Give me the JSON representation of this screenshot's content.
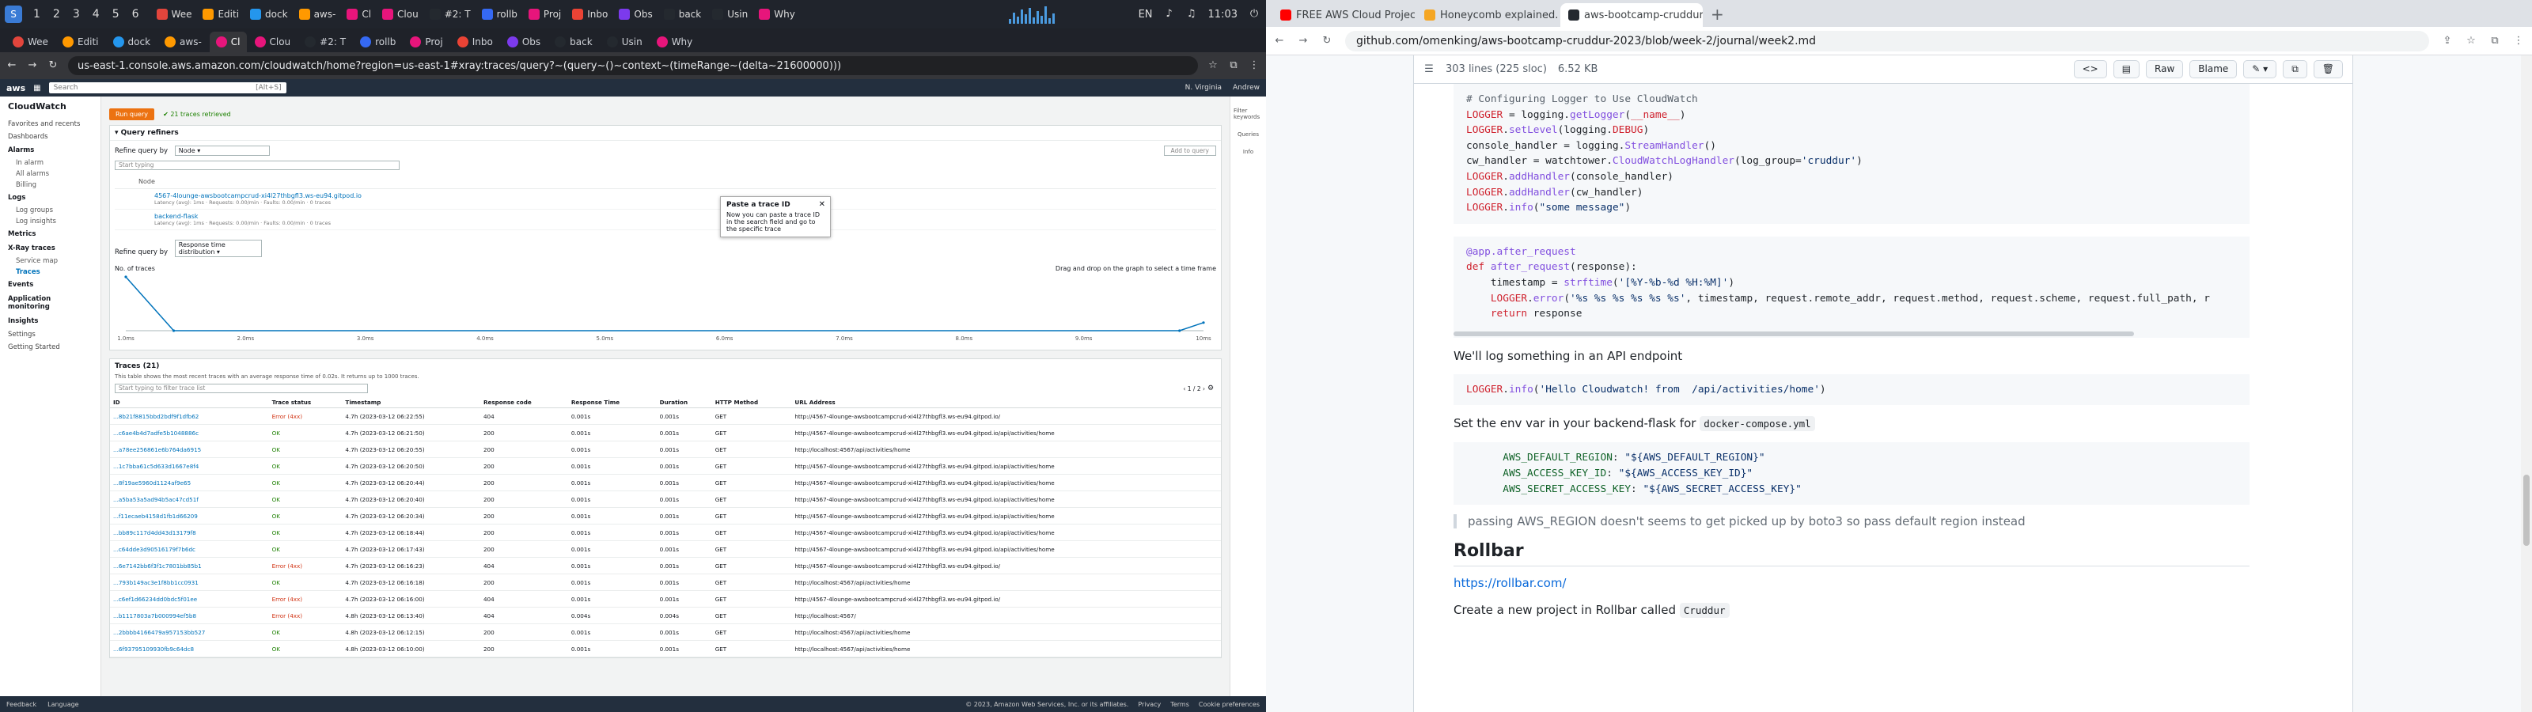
{
  "taskbar": {
    "workspaces": [
      "1",
      "2",
      "3",
      "4",
      "5",
      "6"
    ],
    "windows": [
      {
        "label": "Wee"
      },
      {
        "label": "Editi"
      },
      {
        "label": "dock"
      },
      {
        "label": "aws-"
      },
      {
        "label": "Cl"
      },
      {
        "label": "Clou"
      },
      {
        "label": "#2: T"
      },
      {
        "label": "rollb"
      },
      {
        "label": "Proj"
      },
      {
        "label": "Inbo"
      },
      {
        "label": "Obs"
      },
      {
        "label": "back"
      },
      {
        "label": "Usin"
      },
      {
        "label": "Why"
      }
    ],
    "lang": "EN",
    "time": "11:03"
  },
  "left_browser": {
    "tabs": [
      {
        "label": "Wee"
      },
      {
        "label": "Editi"
      },
      {
        "label": "dock"
      },
      {
        "label": "aws-"
      },
      {
        "label": "Cl"
      },
      {
        "label": "Clou"
      },
      {
        "label": "#2: T"
      },
      {
        "label": "rollb"
      },
      {
        "label": "Proj"
      },
      {
        "label": "Inbo"
      },
      {
        "label": "Obs"
      },
      {
        "label": "back"
      },
      {
        "label": "Usin"
      },
      {
        "label": "Why"
      }
    ],
    "url": "us-east-1.console.aws.amazon.com/cloudwatch/home?region=us-east-1#xray:traces/query?~(query~()~context~(timeRange~(delta~21600000)))"
  },
  "aws": {
    "search_placeholder": "Search",
    "search_hint": "[Alt+S]",
    "top_right": [
      "N. Virginia",
      "Andrew"
    ],
    "sidebar": {
      "title": "CloudWatch",
      "items": [
        {
          "type": "item",
          "label": "Favorites and recents"
        },
        {
          "type": "item",
          "label": "Dashboards"
        },
        {
          "type": "grp",
          "label": "Alarms"
        },
        {
          "type": "sub",
          "label": "In alarm"
        },
        {
          "type": "sub",
          "label": "All alarms"
        },
        {
          "type": "sub",
          "label": "Billing"
        },
        {
          "type": "grp",
          "label": "Logs"
        },
        {
          "type": "sub",
          "label": "Log groups"
        },
        {
          "type": "sub",
          "label": "Log insights"
        },
        {
          "type": "grp",
          "label": "Metrics"
        },
        {
          "type": "grp",
          "label": "X-Ray traces"
        },
        {
          "type": "sub",
          "label": "Service map"
        },
        {
          "type": "sub-active",
          "label": "Traces"
        },
        {
          "type": "grp",
          "label": "Events"
        },
        {
          "type": "grp",
          "label": "Application monitoring"
        },
        {
          "type": "grp",
          "label": "Insights"
        },
        {
          "type": "item",
          "label": "Settings"
        },
        {
          "type": "item",
          "label": "Getting Started"
        }
      ]
    },
    "run_query": "Run query",
    "retrieved": "21 traces retrieved",
    "query_refiners": "Query refiners",
    "refine_label": "Refine query by",
    "refine_value": "Node",
    "filter_placeholder": "Start typing",
    "add_to_query": "Add to query",
    "popup": {
      "title": "Paste a trace ID",
      "body": "Now you can paste a trace ID in the search field and go to the specific trace"
    },
    "nodes_header": "Node",
    "nodes": [
      {
        "name": "4567-4lounge-awsbootcampcrud-xi4l27thbgfl3.ws-eu94.gitpod.io",
        "meta": "Latency (avg): 1ms · Requests: 0.00/min · Faults: 0.00/min · 0 traces"
      },
      {
        "name": "backend-flask",
        "meta": "Latency (avg): 1ms · Requests: 0.00/min · Faults: 0.00/min · 0 traces"
      }
    ],
    "refine2_value": "Response time distribution",
    "chart_hint": "Drag and drop on the graph to select a time frame",
    "traces_title": "Traces (21)",
    "traces_desc": "This table shows the most recent traces with an average response time of 0.02s. It returns up to 1000 traces.",
    "traces_filter": "Start typing to filter trace list",
    "pager": "1 / 2",
    "columns": [
      "ID",
      "Trace status",
      "Timestamp",
      "Response code",
      "Response Time",
      "Duration",
      "HTTP Method",
      "URL Address"
    ],
    "rows": [
      {
        "id": "...8b21f8815bbd2bdf9f1dfb62",
        "status": "Error (4xx)",
        "ts": "4.7h (2023-03-12 06:22:55)",
        "code": "404",
        "rt": "0.001s",
        "dur": "0.001s",
        "m": "GET",
        "url": "http://4567-4lounge-awsbootcampcrud-xi4l27thbgfl3.ws-eu94.gitpod.io/"
      },
      {
        "id": "...c6ae4b4d7adfe5b1048886c",
        "status": "OK",
        "ts": "4.7h (2023-03-12 06:21:50)",
        "code": "200",
        "rt": "0.001s",
        "dur": "0.001s",
        "m": "GET",
        "url": "http://4567-4lounge-awsbootcampcrud-xi4l27thbgfl3.ws-eu94.gitpod.io/api/activities/home"
      },
      {
        "id": "...a78ee256861e6b764da6915",
        "status": "OK",
        "ts": "4.7h (2023-03-12 06:20:55)",
        "code": "200",
        "rt": "0.001s",
        "dur": "0.001s",
        "m": "GET",
        "url": "http://localhost:4567/api/activities/home"
      },
      {
        "id": "...1c7bba61c5d633d1667e8f4",
        "status": "OK",
        "ts": "4.7h (2023-03-12 06:20:50)",
        "code": "200",
        "rt": "0.001s",
        "dur": "0.001s",
        "m": "GET",
        "url": "http://4567-4lounge-awsbootcampcrud-xi4l27thbgfl3.ws-eu94.gitpod.io/api/activities/home"
      },
      {
        "id": "...8f19ae5960d1124af9e65",
        "status": "OK",
        "ts": "4.7h (2023-03-12 06:20:44)",
        "code": "200",
        "rt": "0.001s",
        "dur": "0.001s",
        "m": "GET",
        "url": "http://4567-4lounge-awsbootcampcrud-xi4l27thbgfl3.ws-eu94.gitpod.io/api/activities/home"
      },
      {
        "id": "...a5ba53a5ad94b5ac47cd51f",
        "status": "OK",
        "ts": "4.7h (2023-03-12 06:20:40)",
        "code": "200",
        "rt": "0.001s",
        "dur": "0.001s",
        "m": "GET",
        "url": "http://4567-4lounge-awsbootcampcrud-xi4l27thbgfl3.ws-eu94.gitpod.io/api/activities/home"
      },
      {
        "id": "...f11ecaeb4158d1fb1d66209",
        "status": "OK",
        "ts": "4.7h (2023-03-12 06:20:34)",
        "code": "200",
        "rt": "0.001s",
        "dur": "0.001s",
        "m": "GET",
        "url": "http://4567-4lounge-awsbootcampcrud-xi4l27thbgfl3.ws-eu94.gitpod.io/api/activities/home"
      },
      {
        "id": "...bb89c117d4dd43d13179f8",
        "status": "OK",
        "ts": "4.7h (2023-03-12 06:18:44)",
        "code": "200",
        "rt": "0.001s",
        "dur": "0.001s",
        "m": "GET",
        "url": "http://4567-4lounge-awsbootcampcrud-xi4l27thbgfl3.ws-eu94.gitpod.io/api/activities/home"
      },
      {
        "id": "...c64dde3d90516179f7b6dc",
        "status": "OK",
        "ts": "4.7h (2023-03-12 06:17:43)",
        "code": "200",
        "rt": "0.001s",
        "dur": "0.001s",
        "m": "GET",
        "url": "http://4567-4lounge-awsbootcampcrud-xi4l27thbgfl3.ws-eu94.gitpod.io/api/activities/home"
      },
      {
        "id": "...6e7142bb6f3f1c7801bb85b1",
        "status": "Error (4xx)",
        "ts": "4.7h (2023-03-12 06:16:23)",
        "code": "404",
        "rt": "0.001s",
        "dur": "0.001s",
        "m": "GET",
        "url": "http://4567-4lounge-awsbootcampcrud-xi4l27thbgfl3.ws-eu94.gitpod.io/"
      },
      {
        "id": "...793b149ac3e1f8bb1cc0931",
        "status": "OK",
        "ts": "4.7h (2023-03-12 06:16:18)",
        "code": "200",
        "rt": "0.001s",
        "dur": "0.001s",
        "m": "GET",
        "url": "http://localhost:4567/api/activities/home"
      },
      {
        "id": "...c6ef1d66234dd0bdc5f01ee",
        "status": "Error (4xx)",
        "ts": "4.7h (2023-03-12 06:16:00)",
        "code": "404",
        "rt": "0.001s",
        "dur": "0.001s",
        "m": "GET",
        "url": "http://4567-4lounge-awsbootcampcrud-xi4l27thbgfl3.ws-eu94.gitpod.io/"
      },
      {
        "id": "...b1117803a7b000994ef5b8",
        "status": "Error (4xx)",
        "ts": "4.8h (2023-03-12 06:13:40)",
        "code": "404",
        "rt": "0.004s",
        "dur": "0.004s",
        "m": "GET",
        "url": "http://localhost:4567/"
      },
      {
        "id": "...2bbbb4166479a957153bb527",
        "status": "OK",
        "ts": "4.8h (2023-03-12 06:12:15)",
        "code": "200",
        "rt": "0.001s",
        "dur": "0.001s",
        "m": "GET",
        "url": "http://localhost:4567/api/activities/home"
      },
      {
        "id": "...6f93795109930fb9c64dc8",
        "status": "OK",
        "ts": "4.8h (2023-03-12 06:10:00)",
        "code": "200",
        "rt": "0.001s",
        "dur": "0.001s",
        "m": "GET",
        "url": "http://localhost:4567/api/activities/home"
      }
    ],
    "footer": {
      "left": [
        "Feedback",
        "Language"
      ],
      "copy": "© 2023, Amazon Web Services, Inc. or its affiliates.",
      "right": [
        "Privacy",
        "Terms",
        "Cookie preferences"
      ]
    },
    "rail": [
      "Filter keywords",
      "Queries",
      "Info"
    ]
  },
  "chart_data": {
    "type": "line",
    "ylabel": "No. of traces",
    "x_ticks": [
      "1.0ms",
      "2.0ms",
      "3.0ms",
      "4.0ms",
      "5.0ms",
      "6.0ms",
      "7.0ms",
      "8.0ms",
      "9.0ms",
      "10ms"
    ],
    "series": [
      {
        "values": [
          [
            1.0,
            20
          ],
          [
            1.4,
            0
          ],
          [
            9.8,
            0
          ],
          [
            10,
            3
          ]
        ]
      }
    ],
    "ylim": [
      0,
      20
    ],
    "color": "#0073bb"
  },
  "right_browser": {
    "tabs": [
      {
        "label": "FREE AWS Cloud Project B",
        "color": "#ff0000"
      },
      {
        "label": "Honeycomb explained.",
        "color": "#f5a623"
      },
      {
        "label": "aws-bootcamp-cruddur-",
        "color": "#24292f",
        "active": true
      }
    ],
    "url": "github.com/omenking/aws-bootcamp-cruddur-2023/blob/week-2/journal/week2.md"
  },
  "github": {
    "lines": "303 lines (225 sloc)",
    "size": "6.52 KB",
    "buttons": [
      "Raw",
      "Blame"
    ],
    "text1": "We'll log something in an API endpoint",
    "text2_pre": "Set the env var in your backend-flask for",
    "text2_code": "docker-compose.yml",
    "quote": "passing AWS_REGION doesn't seems to get picked up by boto3 so pass default region instead",
    "h_rollbar": "Rollbar",
    "link_rollbar": "https://rollbar.com/",
    "text3_pre": "Create a new project in Rollbar called",
    "text3_code": "Cruddur"
  }
}
